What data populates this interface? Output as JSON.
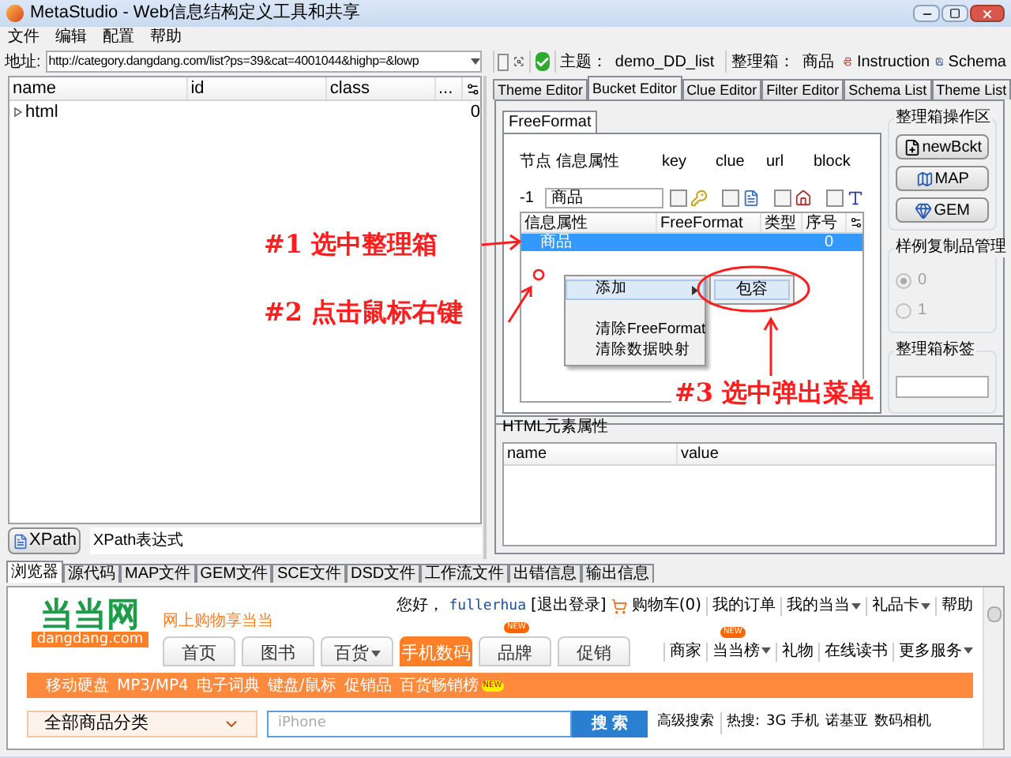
{
  "window": {
    "title": "MetaStudio - Web信息结构定义工具和共享"
  },
  "menu": [
    "文件",
    "编辑",
    "配置",
    "帮助"
  ],
  "address": {
    "label": "地址:",
    "value": "http://category.dangdang.com/list?ps=39&cat=4001044&highp=&lowp"
  },
  "toolbar": {
    "capture_checked": false,
    "theme_label": "主题：",
    "theme": "demo_DD_list",
    "bucket_label": "整理箱：",
    "bucket": "商品",
    "links": [
      "Instruction",
      "Schema"
    ]
  },
  "dom_tree": {
    "columns": [
      "name",
      "id",
      "class",
      "..."
    ],
    "rows": [
      {
        "name": "html",
        "expanded": false,
        "column_4": "0"
      }
    ]
  },
  "xpath": {
    "button": "XPath",
    "placeholder": "XPath表达式"
  },
  "editor_tabs": [
    {
      "label": "Theme Editor",
      "selected": false
    },
    {
      "label": "Bucket Editor",
      "selected": true
    },
    {
      "label": "Clue Editor",
      "selected": false
    },
    {
      "label": "Filter Editor",
      "selected": false
    },
    {
      "label": "Schema List",
      "selected": false
    },
    {
      "label": "Theme List",
      "selected": false
    }
  ],
  "bucket_editor": {
    "inner_tab": "FreeFormat",
    "headers": [
      "节点",
      "信息属性",
      "key",
      "clue",
      "url",
      "block"
    ],
    "node": "-1",
    "attribute": "商品",
    "flags": [
      {
        "kind": "key",
        "checked": false
      },
      {
        "kind": "clue",
        "checked": false
      },
      {
        "kind": "url",
        "checked": false
      },
      {
        "kind": "block",
        "checked": false
      }
    ],
    "table": {
      "columns": [
        "信息属性",
        "FreeFormat",
        "类型",
        "序号"
      ],
      "rows": [
        {
          "attribute": "商品",
          "order": "0",
          "selected": true
        }
      ]
    }
  },
  "side": {
    "ops_title": "整理箱操作区",
    "buttons": [
      {
        "kind": "new",
        "label": "newBckt"
      },
      {
        "kind": "map",
        "label": "MAP"
      },
      {
        "kind": "gem",
        "label": "GEM"
      }
    ],
    "sample_title": "样例复制品管理",
    "sample_disabled": true,
    "sample_options": [
      {
        "label": "0",
        "selected": true
      },
      {
        "label": "1",
        "selected": false
      }
    ],
    "label_title": "整理箱标签"
  },
  "context_menu": {
    "items": [
      {
        "label": "添加",
        "kind": "submenu",
        "selected": true
      },
      {
        "label": "清除FreeFormat",
        "kind": "item",
        "selected": false
      },
      {
        "label": "清除数据映射",
        "kind": "item",
        "selected": false
      }
    ],
    "submenu": [
      {
        "label": "包容",
        "selected": true
      }
    ]
  },
  "html_attrs": {
    "title": "HTML元素属性",
    "columns": [
      "name",
      "value"
    ]
  },
  "bottom_tabs": [
    {
      "label": "浏览器",
      "selected": true
    },
    {
      "label": "源代码",
      "selected": false
    },
    {
      "label": "MAP文件",
      "selected": false
    },
    {
      "label": "GEM文件",
      "selected": false
    },
    {
      "label": "SCE文件",
      "selected": false
    },
    {
      "label": "DSD文件",
      "selected": false
    },
    {
      "label": "工作流文件",
      "selected": false
    },
    {
      "label": "出错信息",
      "selected": false
    },
    {
      "label": "输出信息",
      "selected": false
    }
  ],
  "site": {
    "logo": "当当网",
    "logo_sub": "dangdang.com",
    "slogan": "网上购物享当当",
    "greeting": "您好，",
    "user": "fullerhua",
    "logout": "[退出登录]",
    "cart": "购物车(0)",
    "top_links": [
      {
        "label": "我的订单",
        "dropdown": false
      },
      {
        "label": "我的当当",
        "dropdown": true
      },
      {
        "label": "礼品卡",
        "dropdown": true
      },
      {
        "label": "帮助",
        "dropdown": false
      }
    ],
    "nav": [
      {
        "label": "首页",
        "selected": false,
        "dropdown": false
      },
      {
        "label": "图书",
        "selected": false,
        "dropdown": false
      },
      {
        "label": "百货",
        "selected": false,
        "dropdown": true
      },
      {
        "label": "手机数码",
        "selected": true,
        "dropdown": false
      },
      {
        "label": "品牌",
        "selected": false,
        "badge": "NEW",
        "dropdown": false
      },
      {
        "label": "促销",
        "selected": false,
        "dropdown": false
      }
    ],
    "nav_right": [
      {
        "label": "商家",
        "dropdown": false
      },
      {
        "label": "当当榜",
        "badge": "NEW",
        "dropdown": true
      },
      {
        "label": "礼物",
        "dropdown": false
      },
      {
        "label": "在线读书",
        "dropdown": false
      },
      {
        "label": "更多服务",
        "dropdown": true
      }
    ],
    "sub_nav": [
      {
        "label": "移动硬盘"
      },
      {
        "label": "MP3/MP4"
      },
      {
        "label": "电子词典"
      },
      {
        "label": "键盘/鼠标"
      },
      {
        "label": "促销品"
      },
      {
        "label": "百货畅销榜",
        "badge": "NEW"
      }
    ],
    "category": "全部商品分类",
    "search_placeholder": "iPhone",
    "search_button": "搜 索",
    "advanced": "高级搜索",
    "hot_label": "热搜:",
    "hot": [
      "3G 手机",
      "诺基亚",
      "数码相机"
    ]
  },
  "annotations": [
    {
      "label": "#1 选中整理箱"
    },
    {
      "label": "#2 点击鼠标右键"
    },
    {
      "label": "#3 选中弹出菜单"
    }
  ]
}
